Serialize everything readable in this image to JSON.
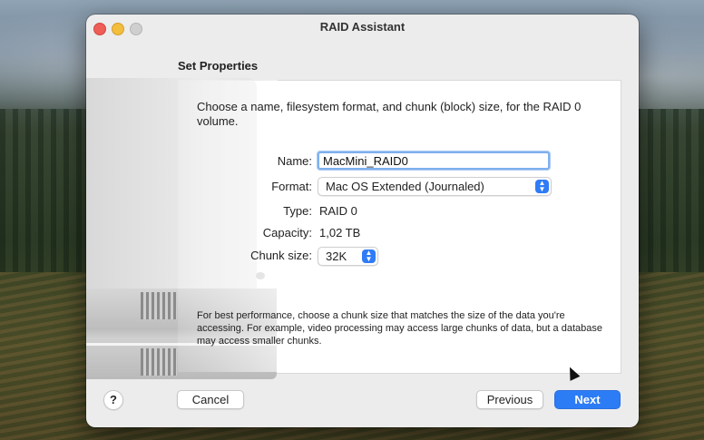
{
  "window": {
    "title": "RAID Assistant"
  },
  "section": {
    "title": "Set Properties"
  },
  "description": "Choose a name, filesystem format, and chunk (block) size, for the RAID 0 volume.",
  "form": {
    "name_label": "Name:",
    "name_value": "MacMini_RAID0",
    "format_label": "Format:",
    "format_value": "Mac OS Extended (Journaled)",
    "type_label": "Type:",
    "type_value": "RAID 0",
    "capacity_label": "Capacity:",
    "capacity_value": "1,02 TB",
    "chunk_label": "Chunk size:",
    "chunk_value": "32K"
  },
  "hint": "For best performance, choose a chunk size that matches the size of the data you're accessing. For example, video processing may access large chunks of data, but a database may access smaller chunks.",
  "buttons": {
    "help": "?",
    "cancel": "Cancel",
    "previous": "Previous",
    "next": "Next"
  },
  "colors": {
    "accent": "#2c7cf6"
  }
}
